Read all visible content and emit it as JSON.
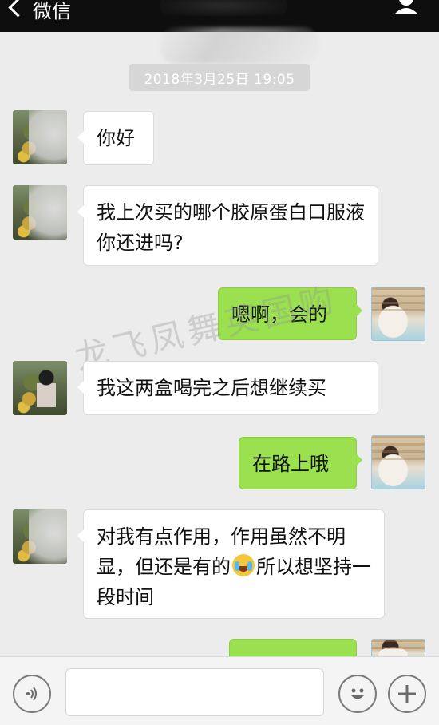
{
  "header": {
    "back_label": "微信",
    "colors": {
      "bar": "#0e0e0e"
    }
  },
  "timestamp": "2018年3月25日 19:05",
  "watermark": "龙飞凤舞英国购",
  "messages": [
    {
      "side": "left",
      "text": "你好"
    },
    {
      "side": "left",
      "text": "我上次买的哪个胶原蛋白口服液你还进吗?"
    },
    {
      "side": "right",
      "text": "嗯啊，会的"
    },
    {
      "side": "left",
      "text": "我这两盒喝完之后想继续买"
    },
    {
      "side": "right",
      "text": "在路上哦"
    },
    {
      "side": "left",
      "text_before": "对我有点作用，作用虽然不明显，但还是有的",
      "emoji": "crying-laughing-emoji",
      "text_after": "所以想坚持一段时间"
    },
    {
      "side": "right",
      "text": ""
    }
  ],
  "input_bar": {
    "voice_icon": "voice-icon",
    "emoji_icon": "smiley-icon",
    "plus_icon": "plus-icon",
    "field_value": ""
  },
  "colors": {
    "background": "#ececec",
    "incoming_bubble": "#ffffff",
    "outgoing_bubble": "#9ae04f"
  }
}
